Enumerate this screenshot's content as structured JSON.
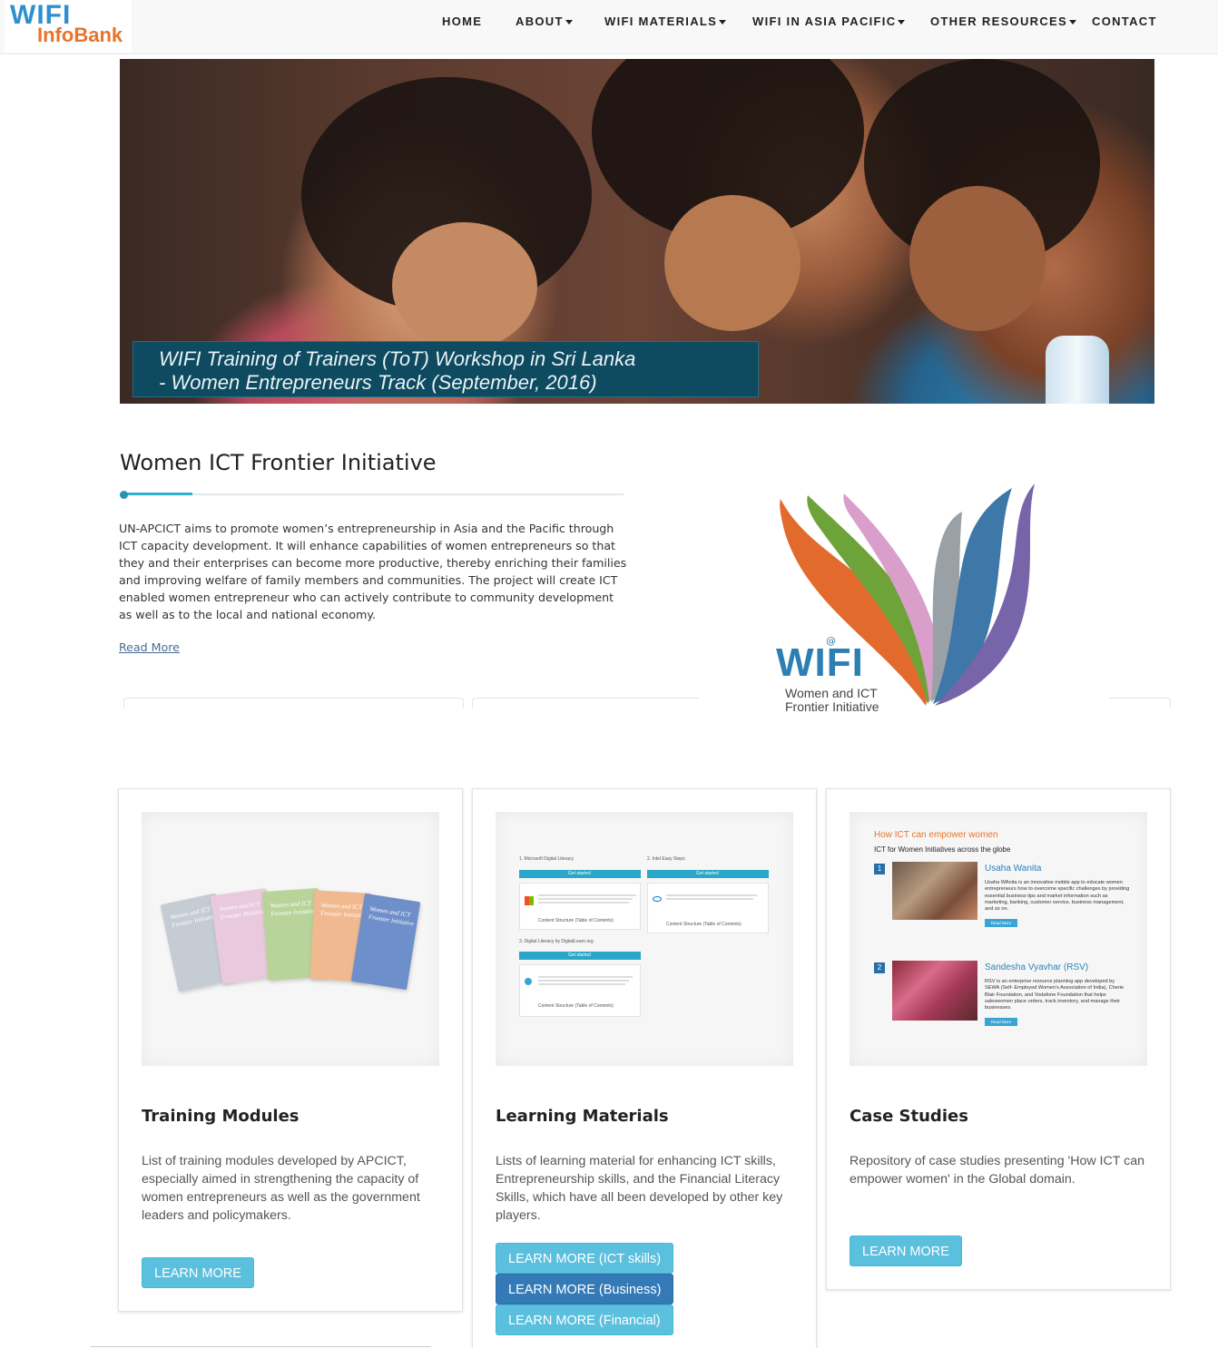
{
  "brand": {
    "line1": "WIFI",
    "line2": "InfoBank"
  },
  "nav": {
    "items": [
      {
        "label": "HOME",
        "dropdown": false
      },
      {
        "label": "ABOUT",
        "dropdown": true
      },
      {
        "label": "WIFI MATERIALS",
        "dropdown": true
      },
      {
        "label": "WIFI IN ASIA PACIFIC",
        "dropdown": true
      },
      {
        "label": "OTHER RESOURCES",
        "dropdown": true
      },
      {
        "label": "CONTACT",
        "dropdown": false
      }
    ]
  },
  "hero": {
    "caption_line1": "WIFI Training of Trainers (ToT) Workshop in Sri Lanka",
    "caption_line2": "- Women Entrepreneurs Track (September, 2016)"
  },
  "intro": {
    "title": "Women ICT Frontier Initiative",
    "body": "UN-APCICT aims to promote women’s entrepreneurship in Asia and the Pacific through ICT capacity development. It will enhance capabilities of women entrepreneurs so that they and their enterprises can become more productive, thereby enriching their families and improving welfare of family members and communities. The project will create ICT enabled women entrepreneur who can actively contribute to community development as well as to the local and national economy.",
    "read_more": "Read More"
  },
  "wifi_logo": {
    "at": "@",
    "word": "WIFI",
    "sub1": "Women and ICT",
    "sub2": "Frontier Initiative"
  },
  "cards": [
    {
      "title": "Training Modules",
      "description": "List of training modules developed by APCICT, especially aimed in strengthening the capacity of women entrepreneurs as well as the government leaders and policymakers.",
      "buttons": [
        "LEARN MORE"
      ],
      "booklets": [
        {
          "text": "Women and ICT Frontier Initiative",
          "color": "#c5ccd4"
        },
        {
          "text": "Women and ICT Frontier Initiative",
          "color": "#e8c9dd"
        },
        {
          "text": "Women and ICT Frontier Initiative",
          "color": "#b8d49a"
        },
        {
          "text": "Women and ICT Frontier Initiative",
          "color": "#f0b990"
        },
        {
          "text": "Women and ICT Frontier Initiative",
          "color": "#6e8fc9"
        }
      ]
    },
    {
      "title": "Learning Materials",
      "description": "Lists of learning material for enhancing ICT skills, Entrepreneurship skills, and the Financial Literacy Skills, which have all been developed by other key players.",
      "buttons": [
        "LEARN MORE (ICT skills)",
        "LEARN MORE (Business)",
        "LEARN MORE (Financial)"
      ],
      "mini": {
        "c1": "1. Microsoft Digital Literacy",
        "c2": "2. Intel Easy Steps",
        "c3": "3. Digital Literacy by DigitalLearn.org",
        "bar": "Get started",
        "toc": "Content Structure (Table of Contents)"
      }
    },
    {
      "title": "Case Studies",
      "description": "Repository of case studies presenting 'How ICT can empower women' in the Global domain.",
      "buttons": [
        "LEARN MORE"
      ],
      "mini": {
        "heading": "How ICT can empower women",
        "subheading": "ICT for Women Initiatives across the globe",
        "items": [
          {
            "num": "1",
            "name": "Usaha Wanita",
            "text": "Usaha WAnita is an innovative mobile app to educate women entrepreneurs how to overcome specific challenges by providing essential business tips and market information such as marketing, banking, customer service, business management, and so on.",
            "btn": "Read More"
          },
          {
            "num": "2",
            "name": "Sandesha Vyavhar (RSV)",
            "text": "RSV is an enterprise resource planning app developed by SEWA (Self- Employed Women's Association of India), Cherie Blair Foundation, and Vodafone Foundation that helps saleswomen place orders, track inventory, and manage their businesses.",
            "btn": "Read More"
          }
        ]
      }
    }
  ],
  "colors": {
    "accent": "#2eafc8",
    "button_info": "#5bc0de",
    "button_primary": "#337ab7",
    "brand_orange": "#e8742b",
    "brand_blue": "#2f8fce"
  }
}
